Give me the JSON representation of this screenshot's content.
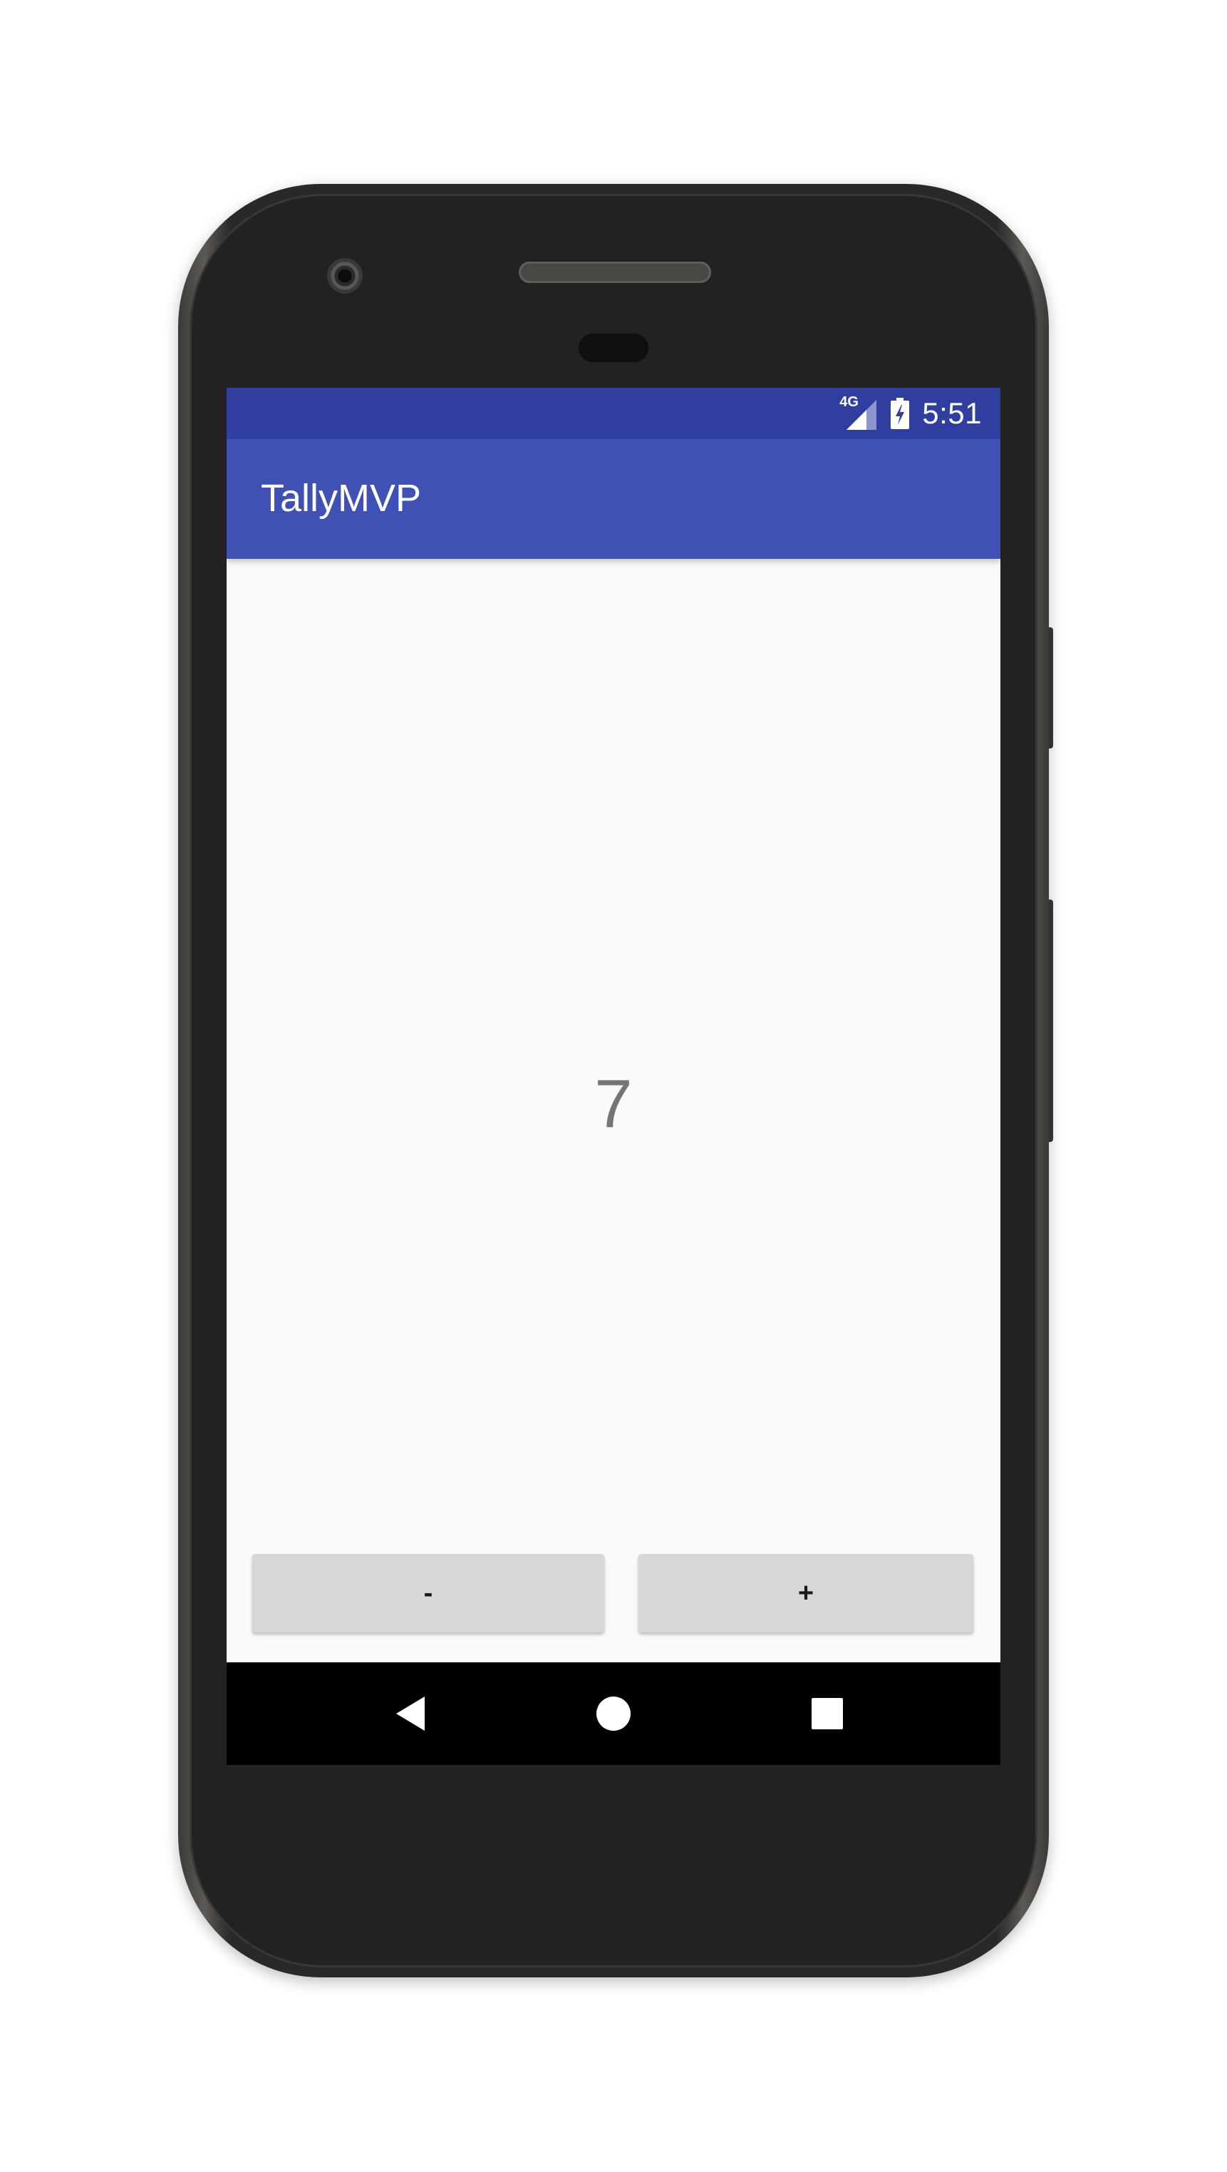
{
  "status_bar": {
    "network_label": "4G",
    "time": "5:51",
    "color": "#303f9f",
    "icons": [
      "signal-icon",
      "battery-charging-icon"
    ]
  },
  "app_bar": {
    "title": "TallyMVP",
    "color": "#3f51b5"
  },
  "main": {
    "count": "7"
  },
  "buttons": {
    "decrement_label": "-",
    "increment_label": "+"
  },
  "nav_bar": {
    "icons": [
      "back-icon",
      "home-icon",
      "recents-icon"
    ]
  }
}
